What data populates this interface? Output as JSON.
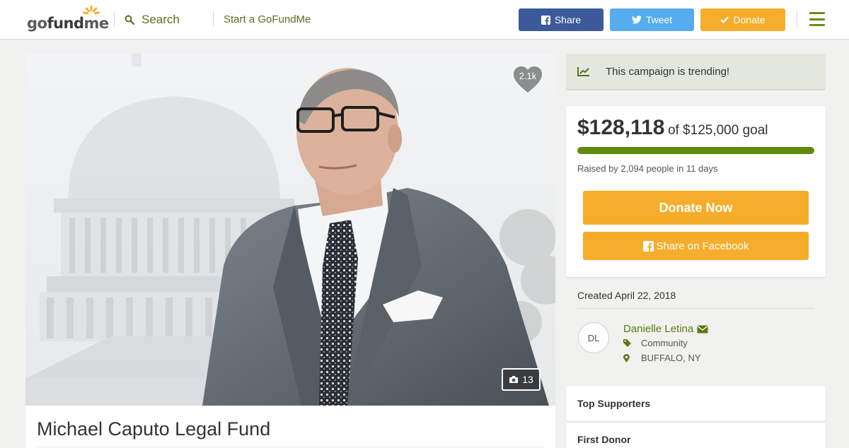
{
  "header": {
    "logo": "gofundme",
    "search_label": "Search",
    "start_label": "Start a GoFundMe",
    "share_label": "Share",
    "tweet_label": "Tweet",
    "donate_label": "Donate"
  },
  "hero": {
    "favorite_count": "2.1k",
    "photo_count": "13"
  },
  "campaign": {
    "title": "Michael Caputo Legal Fund"
  },
  "trending": {
    "text": "This campaign is trending!"
  },
  "funding": {
    "raised": "$128,118",
    "goal_text": "of $125,000 goal",
    "progress_fraction": 1.0,
    "raised_by": "Raised by 2,094 people in 11 days",
    "donate_now_label": "Donate Now",
    "share_facebook_label": "Share on Facebook"
  },
  "organizer": {
    "created": "Created April 22, 2018",
    "initials": "DL",
    "name": "Danielle Letina",
    "category": "Community",
    "location": "BUFFALO, NY"
  },
  "supporters": {
    "top_supporters_label": "Top Supporters",
    "first_donor_label": "First Donor"
  },
  "colors": {
    "brand_green": "#5f8a0b",
    "donate_orange": "#f5ad2b",
    "facebook_blue": "#3c5a99",
    "twitter_blue": "#55acee"
  }
}
